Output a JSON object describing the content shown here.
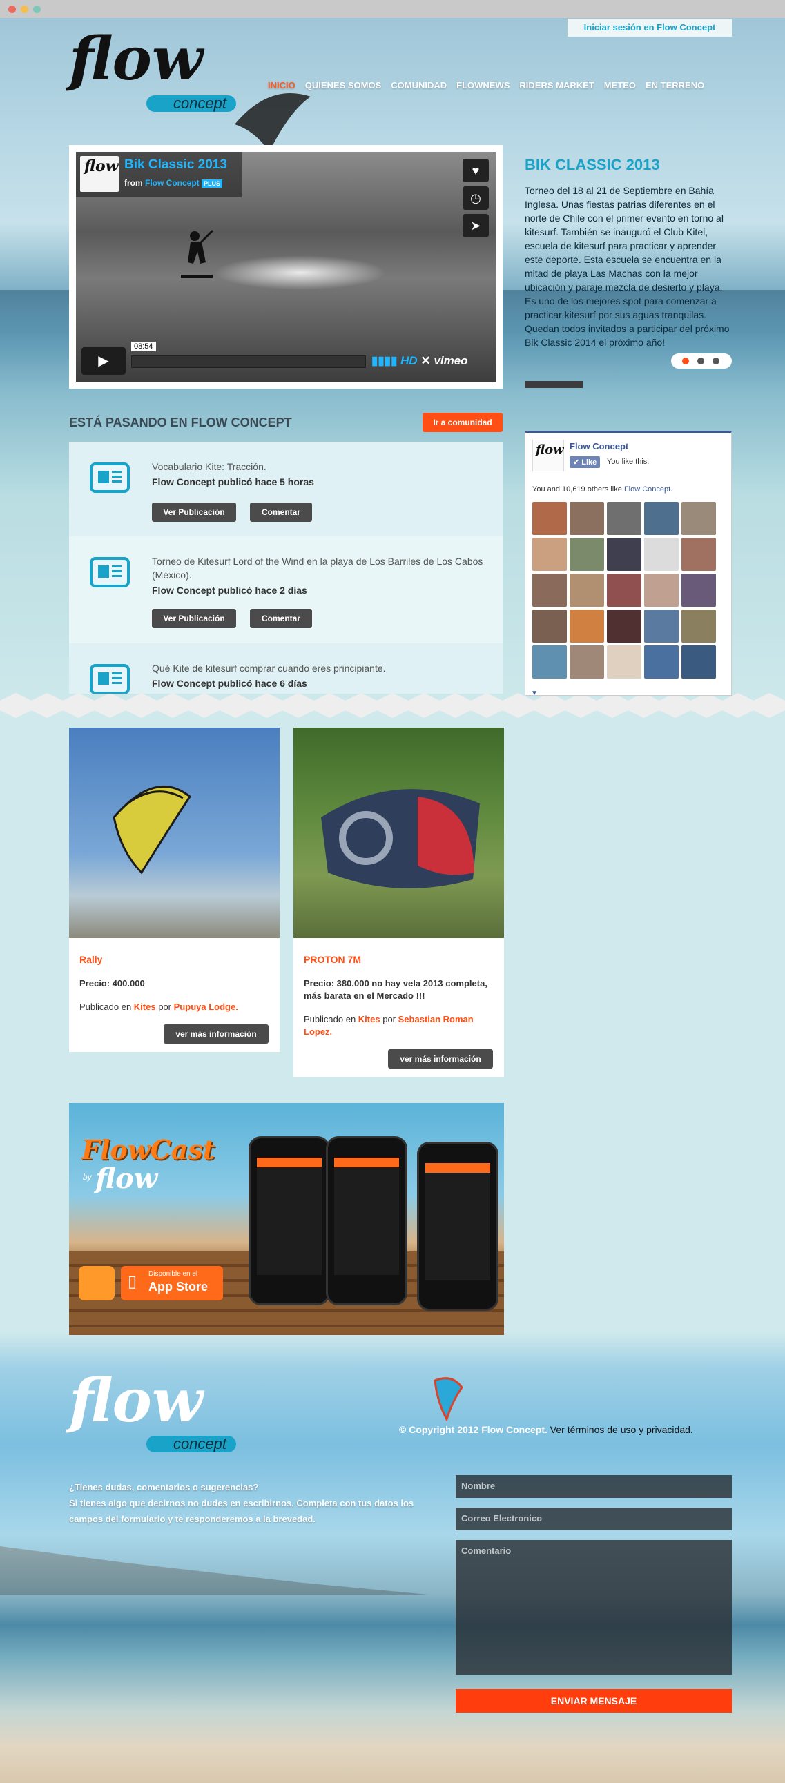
{
  "header": {
    "login_label": "Iniciar sesión en Flow Concept",
    "logo_word": "flow",
    "logo_sub": "concept",
    "nav": [
      {
        "label": "INICIO",
        "active": true
      },
      {
        "label": "QUIENES SOMOS"
      },
      {
        "label": "COMUNIDAD"
      },
      {
        "label": "FLOWNEWS"
      },
      {
        "label": "RIDERS MARKET"
      },
      {
        "label": "METEO"
      },
      {
        "label": "EN TERRENO"
      }
    ]
  },
  "video": {
    "title": "Bik Classic 2013",
    "from_prefix": "from",
    "from_name": "Flow Concept",
    "badge": "PLUS",
    "timecode": "08:54",
    "hd": "HD",
    "vimeo": "vimeo"
  },
  "event": {
    "title": "BIK CLASSIC 2013",
    "body": "Torneo del 18 al 21 de Septiembre en Bahía Inglesa. Unas fiestas patrias diferentes en el norte de Chile con el primer evento en torno al kitesurf. También se inauguró el Club Kitel, escuela de kitesurf para practicar y aprender este deporte. Esta escuela se encuentra en la mitad de playa Las Machas con la mejor ubicación y paraje mezcla de desierto y playa. Es uno de los mejores spot para comenzar a practicar kitesurf por sus aguas tranquilas. Quedan todos invitados a participar del próximo Bik Classic 2014 el próximo año!"
  },
  "community": {
    "title": "ESTÁ PASANDO EN FLOW CONCEPT",
    "button": "Ir a comunidad",
    "items": [
      {
        "text": "Vocabulario Kite: Tracción.",
        "meta": "Flow Concept publicó hace 5 horas",
        "btn_view": "Ver Publicación",
        "btn_comment": "Comentar"
      },
      {
        "text": "Torneo de Kitesurf Lord of the Wind en la playa de Los Barriles de Los Cabos (México).",
        "meta": "Flow Concept publicó hace 2 días",
        "btn_view": "Ver Publicación",
        "btn_comment": "Comentar"
      },
      {
        "text": "Qué Kite de kitesurf comprar cuando eres principiante.",
        "meta": "Flow Concept publicó hace 6 días"
      }
    ]
  },
  "facebook": {
    "page_name": "Flow Concept",
    "like_label": "Like",
    "you_like": "You like this.",
    "count_prefix": "You and 10,619 others like",
    "count_link": "Flow Concept."
  },
  "listings": [
    {
      "title": "Rally",
      "price": "Precio: 400.000",
      "pub_prefix": "Publicado en",
      "category": "Kites",
      "by": "por",
      "author": "Pupuya Lodge.",
      "button": "ver más información"
    },
    {
      "title": "PROTON 7M",
      "price": "Precio: 380.000 no hay vela 2013 completa, más barata en el Mercado !!!",
      "pub_prefix": "Publicado en",
      "category": "Kites",
      "by": "por",
      "author": "Sebastian Roman Lopez.",
      "button": "ver más información"
    }
  ],
  "app_banner": {
    "title": "FlowCast",
    "by": "by",
    "store_small": "Disponible en el",
    "store_big": "App Store"
  },
  "footer": {
    "copyright": "© Copyright 2012 Flow Concept.",
    "terms": "Ver términos de uso y privacidad.",
    "contact_line1": "¿Tienes dudas, comentarios o sugerencias?",
    "contact_line2": "Si tienes algo que decirnos no dudes en escribirnos. Completa con tus datos los campos del formulario y te responderemos a la brevedad.",
    "name_placeholder": "Nombre",
    "email_placeholder": "Correo Electronico",
    "comment_placeholder": "Comentario",
    "send": "ENVIAR MENSAJE"
  },
  "colors": {
    "accent": "#1aa3c9",
    "orange": "#ff4f14",
    "dark_button": "#4b4b4b"
  }
}
